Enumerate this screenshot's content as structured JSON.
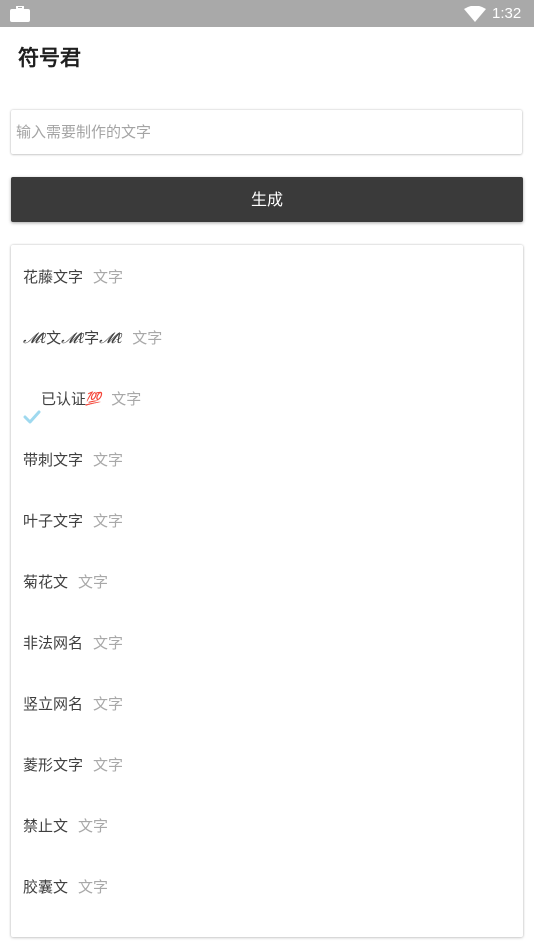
{
  "status_bar": {
    "time": "1:32",
    "left_icon": "briefcase-icon",
    "right_icon": "wifi-icon"
  },
  "app": {
    "title": "符号君"
  },
  "input": {
    "placeholder": "输入需要制作的文字",
    "value": ""
  },
  "generate_button": {
    "label": "生成"
  },
  "list": {
    "items": [
      {
        "name": "花藤文字",
        "tag": "文字"
      },
      {
        "name_parts": [
          "𝓜ℓ",
          "文",
          "𝓜ℓ",
          "字",
          "𝓜ℓ"
        ],
        "tag": "文字"
      },
      {
        "name": "已认证",
        "badge": "💯",
        "tag": "文字"
      },
      {
        "name": "带刺文字",
        "tag": "文字"
      },
      {
        "name": "叶子文字",
        "tag": "文字"
      },
      {
        "name": "菊花文",
        "tag": "文字"
      },
      {
        "name": "非法网名",
        "tag": "文字"
      },
      {
        "name": "竖立网名",
        "tag": "文字"
      },
      {
        "name": "菱形文字",
        "tag": "文字"
      },
      {
        "name": "禁止文",
        "tag": "文字"
      },
      {
        "name": "胶囊文",
        "tag": "文字"
      }
    ]
  },
  "colors": {
    "status_bar": "#a9a9a9",
    "button": "#3a3a3a",
    "item_text": "#3f3f3f",
    "tag_text": "#a8a8a8",
    "check": "#9fd9ef",
    "badge": "#e98a6b"
  }
}
